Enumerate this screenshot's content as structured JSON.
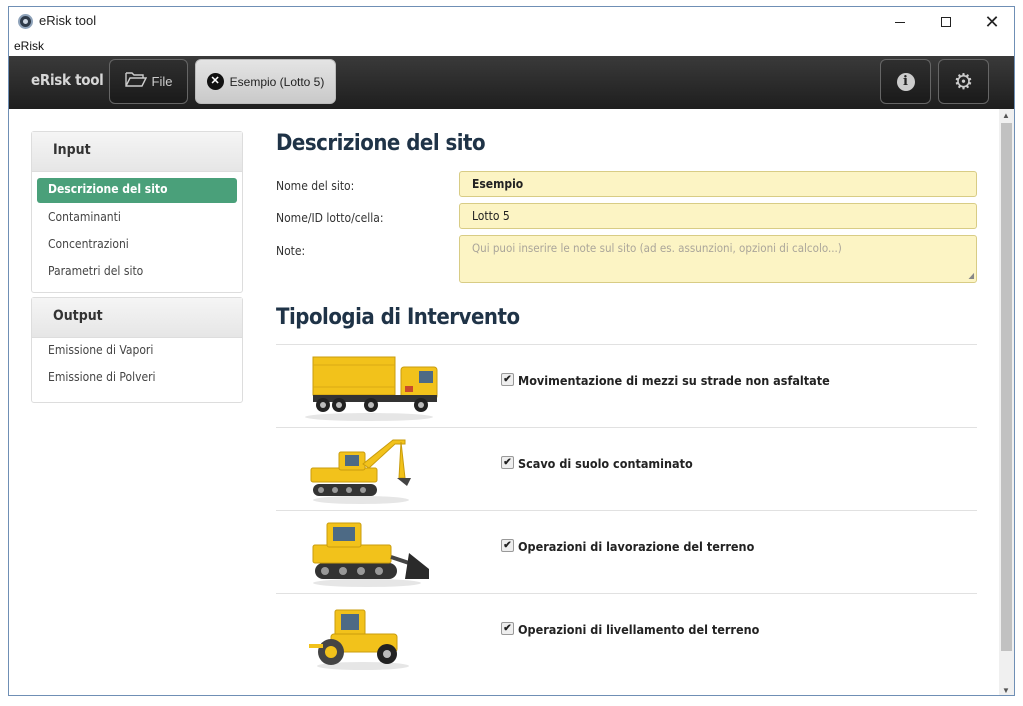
{
  "window": {
    "title": "eRisk tool"
  },
  "menu": {
    "items": [
      "eRisk"
    ]
  },
  "toolbar": {
    "brand": "eRisk tool",
    "file_label": "File",
    "tab_label": "Esempio (Lotto 5)"
  },
  "sidebar": {
    "input_header": "Input",
    "input_items": [
      "Descrizione del sito",
      "Contaminanti",
      "Concentrazioni",
      "Parametri del sito"
    ],
    "output_header": "Output",
    "output_items": [
      "Emissione di Vapori",
      "Emissione di Polveri"
    ]
  },
  "site": {
    "title": "Descrizione del sito",
    "name_label": "Nome del sito:",
    "name_value": "Esempio",
    "lot_label": "Nome/ID lotto/cella:",
    "lot_value": "Lotto 5",
    "notes_label": "Note:",
    "notes_placeholder": "Qui puoi inserire le note sul sito (ad es. assunzioni, opzioni di calcolo...)"
  },
  "intervention": {
    "title": "Tipologia di Intervento",
    "options": [
      {
        "label": "Movimentazione di mezzi su strade non asfaltate",
        "checked": true,
        "icon": "dump-truck-icon"
      },
      {
        "label": "Scavo di suolo contaminato",
        "checked": true,
        "icon": "excavator-icon"
      },
      {
        "label": "Operazioni di lavorazione del terreno",
        "checked": true,
        "icon": "bulldozer-icon"
      },
      {
        "label": "Operazioni di livellamento del terreno",
        "checked": true,
        "icon": "road-roller-icon"
      }
    ]
  },
  "colors": {
    "accent": "#4aa07a",
    "field_bg": "#fcf4c4",
    "toolbar_bg": "#2a2a2a",
    "machine_yellow": "#f2c21b"
  }
}
